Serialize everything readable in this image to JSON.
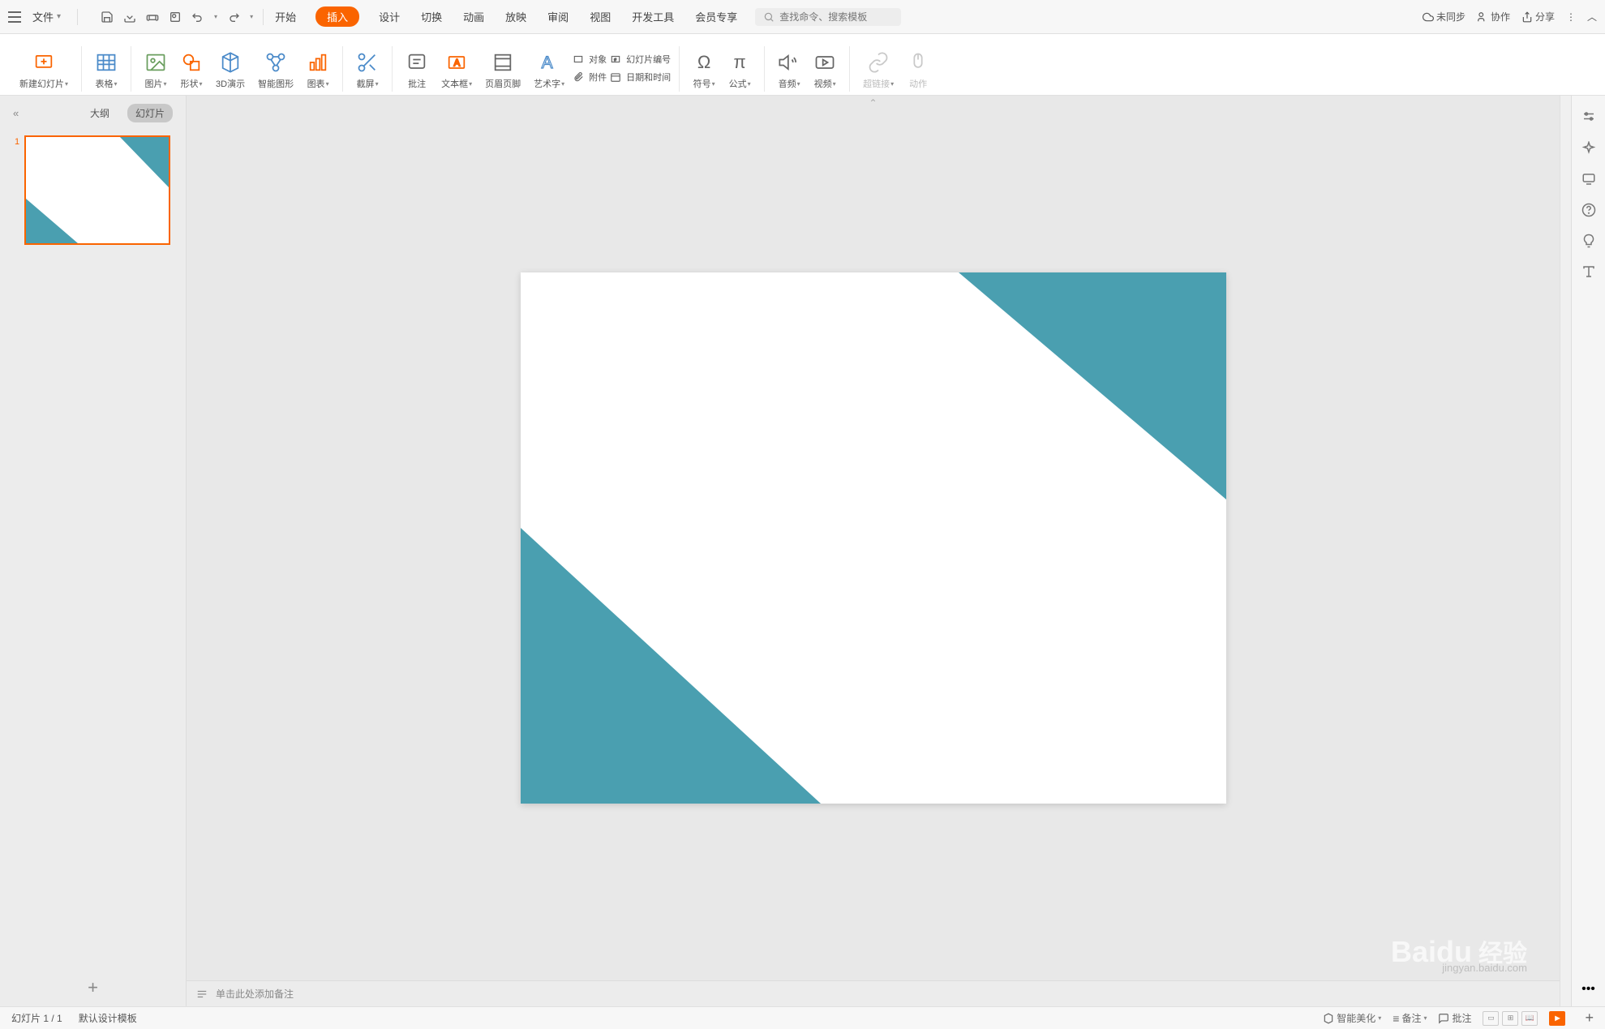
{
  "topbar": {
    "file_label": "文件",
    "search_placeholder": "查找命令、搜索模板",
    "sync_label": "未同步",
    "collab_label": "协作",
    "share_label": "分享"
  },
  "tabs": {
    "start": "开始",
    "insert": "插入",
    "design": "设计",
    "transition": "切换",
    "animation": "动画",
    "show": "放映",
    "review": "审阅",
    "view": "视图",
    "devtools": "开发工具",
    "member": "会员专享"
  },
  "ribbon": {
    "new_slide": "新建幻灯片",
    "table": "表格",
    "picture": "图片",
    "shape": "形状",
    "threed": "3D演示",
    "smartart": "智能图形",
    "chart": "图表",
    "screenshot": "截屏",
    "annotate": "批注",
    "textbox": "文本框",
    "header_footer": "页眉页脚",
    "wordart": "艺术字",
    "object": "对象",
    "slide_num": "幻灯片编号",
    "attachment": "附件",
    "datetime": "日期和时间",
    "symbol": "符号",
    "equation": "公式",
    "audio": "音频",
    "video": "视频",
    "hyperlink": "超链接",
    "action": "动作"
  },
  "left_panel": {
    "outline_tab": "大纲",
    "slides_tab": "幻灯片",
    "slide_number": "1"
  },
  "notes": {
    "placeholder": "单击此处添加备注"
  },
  "status": {
    "slide_counter": "幻灯片 1 / 1",
    "template": "默认设计模板",
    "beautify": "智能美化",
    "remarks": "备注",
    "annotate": "批注"
  },
  "watermark": {
    "brand": "Baidu",
    "cn": "经验",
    "url": "jingyan.baidu.com"
  }
}
